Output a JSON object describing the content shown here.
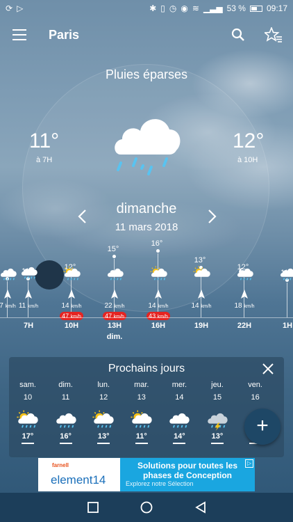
{
  "status": {
    "battery": "53 %",
    "time": "09:17"
  },
  "appbar": {
    "city": "Paris"
  },
  "current": {
    "condition": "Pluies éparses",
    "left_temp": "11°",
    "left_time": "à 7H",
    "right_temp": "12°",
    "right_time": "à 10H",
    "day": "dimanche",
    "date": "11 mars 2018"
  },
  "hourly": [
    {
      "temp": "",
      "icon": "rain-cloud-icon",
      "speed": "7",
      "gust": "",
      "label": ""
    },
    {
      "temp": "11°",
      "icon": "rain-cloud-icon",
      "speed": "11",
      "gust": "",
      "label": "7H"
    },
    {
      "temp": "12°",
      "icon": "sun-rain-icon",
      "speed": "14",
      "gust": "47",
      "label": "10H"
    },
    {
      "temp": "15°",
      "icon": "rain-cloud-icon",
      "speed": "22",
      "gust": "47",
      "label": "13H"
    },
    {
      "temp": "16°",
      "icon": "sun-rain-icon",
      "speed": "14",
      "gust": "43",
      "label": "16H"
    },
    {
      "temp": "13°",
      "icon": "sun-cloud-icon",
      "speed": "14",
      "gust": "",
      "label": "19H"
    },
    {
      "temp": "12°",
      "icon": "moon-rain-icon",
      "speed": "18",
      "gust": "",
      "label": "22H"
    },
    {
      "temp": "11°",
      "icon": "rain-cloud-icon",
      "speed": "",
      "gust": "",
      "label": "1H"
    }
  ],
  "hourly_extra": {
    "sublabel": "dim.",
    "unit": "km/h"
  },
  "next_days": {
    "title": "Prochains jours",
    "days": [
      {
        "name": "sam.",
        "date": "10",
        "icon": "sun-rain-icon",
        "temp": "17°"
      },
      {
        "name": "dim.",
        "date": "11",
        "icon": "rain-cloud-icon",
        "temp": "16°"
      },
      {
        "name": "lun.",
        "date": "12",
        "icon": "sun-rain-icon",
        "temp": "13°"
      },
      {
        "name": "mar.",
        "date": "13",
        "icon": "sun-rain-icon",
        "temp": "11°"
      },
      {
        "name": "mer.",
        "date": "14",
        "icon": "rain-cloud-icon",
        "temp": "14°"
      },
      {
        "name": "jeu.",
        "date": "15",
        "icon": "storm-cloud-icon",
        "temp": "13°"
      },
      {
        "name": "ven.",
        "date": "16",
        "icon": "rain-cloud-icon",
        "temp": "12°"
      }
    ]
  },
  "fab": {
    "label": "+"
  },
  "ad": {
    "brand": "farnell",
    "logo": "element14",
    "line1": "Solutions pour toutes les",
    "line2": "phases de Conception",
    "sub": "Explorez notre Sélection"
  }
}
